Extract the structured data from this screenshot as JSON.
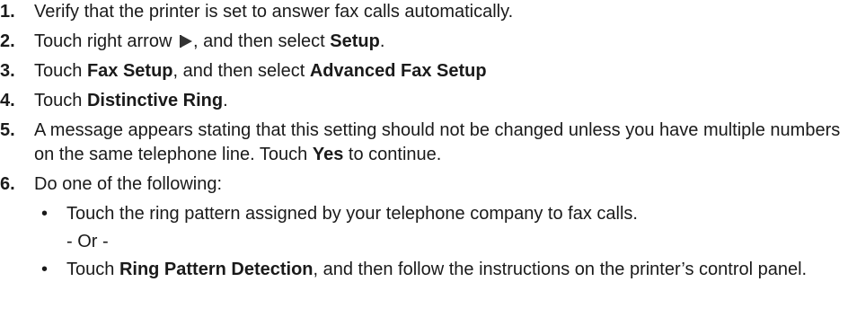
{
  "steps": [
    {
      "num": "1.",
      "text": "Verify that the printer is set to answer fax calls automatically."
    },
    {
      "num": "2.",
      "prefix": "Touch right arrow ",
      "arrow_icon": "right-arrow-icon",
      "middle": ", and then select ",
      "bold": "Setup",
      "suffix": "."
    },
    {
      "num": "3.",
      "prefix": "Touch ",
      "bold1": "Fax Setup",
      "middle": ", and then select ",
      "bold2": "Advanced Fax Setup"
    },
    {
      "num": "4.",
      "prefix": "Touch ",
      "bold": "Distinctive Ring",
      "suffix": "."
    },
    {
      "num": "5.",
      "prefix": "A message appears stating that this setting should not be changed unless you have multiple numbers on the same telephone line. Touch ",
      "bold": "Yes",
      "suffix": " to continue."
    },
    {
      "num": "6.",
      "text": "Do one of the following:",
      "sub": [
        {
          "bullet": "•",
          "text": "Touch the ring pattern assigned by your telephone company to fax calls.",
          "or": "- Or -"
        },
        {
          "bullet": "•",
          "prefix": "Touch ",
          "bold": "Ring Pattern Detection",
          "suffix": ", and then follow the instructions on the printer’s control panel."
        }
      ]
    }
  ]
}
